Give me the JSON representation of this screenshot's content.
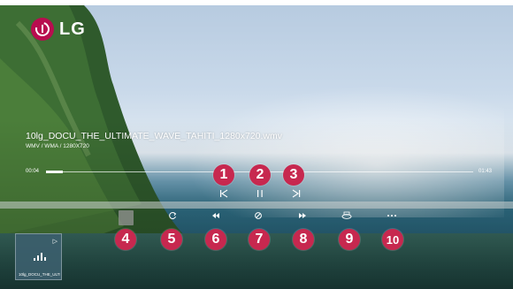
{
  "brand": {
    "name": "LG",
    "color": "#b80d4f"
  },
  "media": {
    "title": "10lg_DOCU_THE_ULTIMATE_WAVE_TAHITI_1280x720.wmv",
    "meta": "WMV / WMA / 1280X720",
    "current_time": "00:04",
    "total_time": "01:43",
    "progress_percent": 3.9
  },
  "controls": {
    "previous_icon": "skip-previous-icon",
    "pause_icon": "pause-icon",
    "next_icon": "skip-next-icon",
    "stop_icon": "stop-icon",
    "repeat_icon": "repeat-icon",
    "rewind_icon": "rewind-icon",
    "reload_icon": "sync-icon",
    "fast_forward_icon": "fast-forward-icon",
    "settings_icon": "360-view-icon",
    "more_icon": "more-options-icon"
  },
  "callouts": [
    "1",
    "2",
    "3",
    "4",
    "5",
    "6",
    "7",
    "8",
    "9",
    "10"
  ],
  "callout_color": "#c7284f",
  "playlist": {
    "thumb_label": "10lg_DOCU_THE_ULTI..."
  }
}
